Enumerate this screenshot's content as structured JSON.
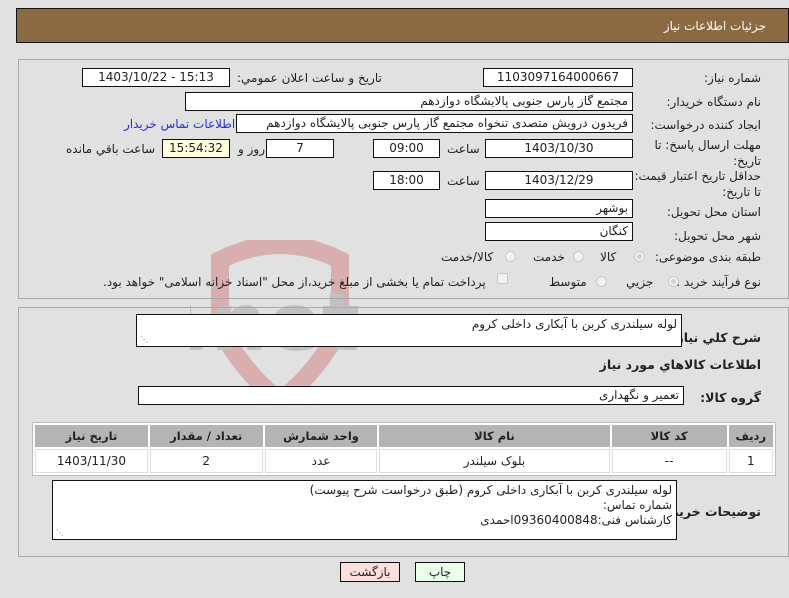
{
  "header": {
    "title": "جزئيات اطلاعات نیاز"
  },
  "form": {
    "need_number": {
      "label": "شماره نیاز:",
      "value": "1103097164000667"
    },
    "announce_datetime": {
      "label": "تاریخ و ساعت اعلان عمومي:",
      "value": "1403/10/22 - 15:13"
    },
    "buyer_org": {
      "label": "نام دستگاه خریدار:",
      "value": "مجتمع گاز پارس جنوبی  پالایشگاه دوازدهم"
    },
    "requester": {
      "label": "ایجاد کننده درخواست:",
      "value": "فریدون درویش متصدی تنخواه مجتمع گاز پارس جنوبی  پالایشگاه دوازدهم"
    },
    "buyer_contact_link": "اطلاعات تماس خریدار",
    "response_deadline": {
      "label": "مهلت ارسال پاسخ: تا تاریخ:",
      "date": "1403/10/30",
      "time_label": "ساعت",
      "time": "09:00",
      "days": "7",
      "days_label": "روز و",
      "remaining": "15:54:32",
      "remaining_label": "ساعت باقي مانده"
    },
    "price_validity": {
      "label": "حداقل تاریخ اعتبار قیمت: تا تاریخ:",
      "date": "1403/12/29",
      "time_label": "ساعت",
      "time": "18:00"
    },
    "province": {
      "label": "استان محل تحویل:",
      "value": "بوشهر"
    },
    "city": {
      "label": "شهر محل تحویل:",
      "value": "کنگان"
    },
    "category": {
      "label": "طبقه بندی موضوعی:",
      "options": [
        "کالا",
        "خدمت",
        "کالا/خدمت"
      ],
      "selected": "کالا"
    },
    "purchase_type": {
      "label": "نوع فرآیند خرید :",
      "options": [
        "جزیي",
        "متوسط"
      ],
      "selected": "جزیي",
      "treasury_note": "پرداخت تمام یا بخشی از مبلغ خرید،از محل \"اسناد خزانه اسلامی\" خواهد بود."
    }
  },
  "details": {
    "summary_label": "شرح کلي نیاز:",
    "summary_value": "لوله سیلندری کربن با آبکاری داخلی کروم",
    "goods_section_title": "اطلاعات کالاهاي مورد نیاز",
    "goods_group_label": "گروه کالا:",
    "goods_group_value": "تعمیر و نگهداری",
    "table": {
      "headers": [
        "ردیف",
        "کد کالا",
        "نام کالا",
        "واحد شمارش",
        "تعداد / مقدار",
        "تاریخ نیاز"
      ],
      "rows": [
        [
          "1",
          "--",
          "بلوک سیلندر",
          "عدد",
          "2",
          "1403/11/30"
        ]
      ]
    },
    "buyer_notes_label": "توضیحات خریدار:",
    "buyer_notes_lines": [
      "لوله سیلندری کربن با آبکاری داخلی کروم (طبق درخواست شرح پیوست)",
      "شماره تماس:",
      "کارشناس فنی:09360400848احمدی"
    ]
  },
  "buttons": {
    "print": "چاپ",
    "back": "بازگشت"
  },
  "colors": {
    "header": "#8b6a42",
    "print_bg": "#eaffea",
    "back_bg": "#ffdede"
  },
  "watermark": "AriaTender.net"
}
